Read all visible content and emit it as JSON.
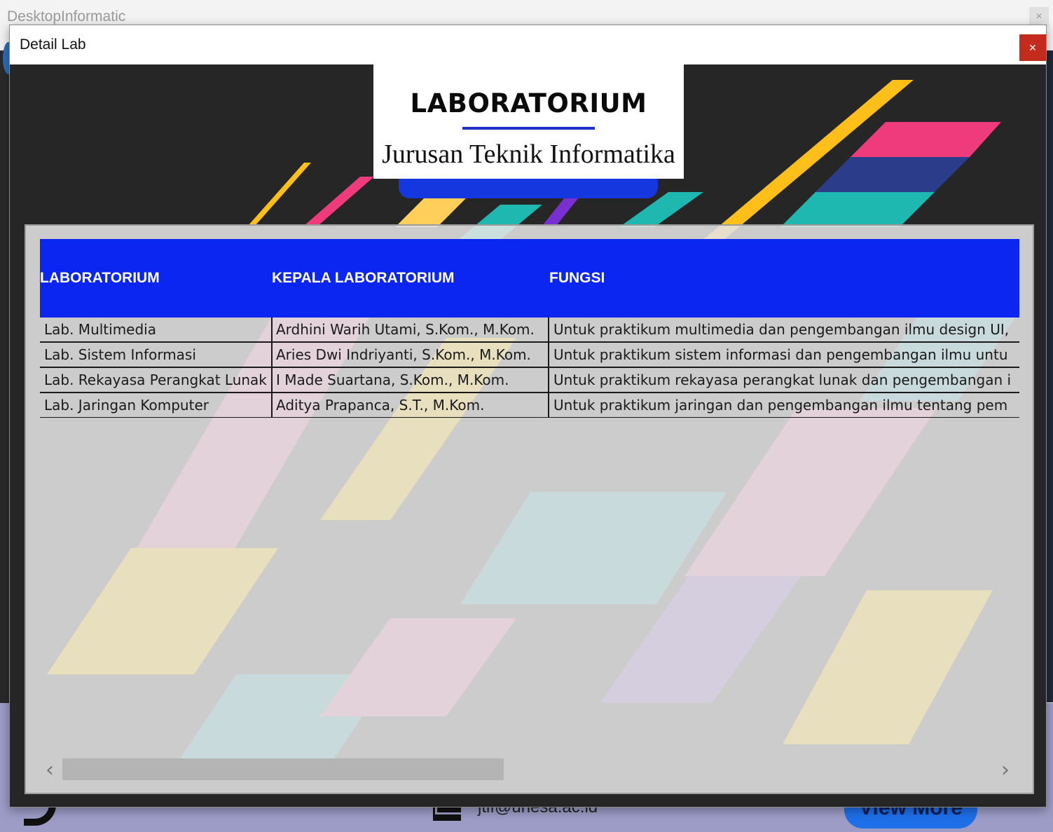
{
  "background_window": {
    "title": "DesktopInformatic",
    "close_label": "×",
    "email": "jtif@unesa.ac.id",
    "view_more_label": "View More"
  },
  "dialog": {
    "title": "Detail Lab",
    "close_label": "×"
  },
  "header": {
    "title": "LABORATORIUM",
    "subtitle": "Jurusan Teknik Informatika"
  },
  "table": {
    "columns": [
      "LABORATORIUM",
      "KEPALA LABORATORIUM",
      "FUNGSI"
    ],
    "rows": [
      [
        "Lab. Multimedia",
        "Ardhini Warih Utami, S.Kom., M.Kom.",
        "Untuk praktikum multimedia dan pengembangan ilmu design UI,"
      ],
      [
        "Lab. Sistem Informasi",
        "Aries Dwi Indriyanti, S.Kom., M.Kom.",
        "Untuk praktikum sistem informasi dan pengembangan ilmu untu"
      ],
      [
        "Lab. Rekayasa Perangkat Lunak",
        "I Made Suartana, S.Kom., M.Kom.",
        "Untuk praktikum rekayasa perangkat lunak dan pengembangan i"
      ],
      [
        "Lab. Jaringan Komputer",
        "Aditya Prapanca, S.T., M.Kom.",
        "Untuk praktikum jaringan dan pengembangan ilmu tentang pem"
      ]
    ]
  },
  "scrollbar": {
    "left_arrow": "‹",
    "right_arrow": "›"
  },
  "colors": {
    "header_blue": "#0a26f0",
    "close_red": "#c42b1c",
    "stripe_yellow": "#ffbf1a",
    "stripe_pink": "#ef3b7c",
    "stripe_teal": "#1fb8b0",
    "stripe_purple": "#7a2fd0"
  }
}
